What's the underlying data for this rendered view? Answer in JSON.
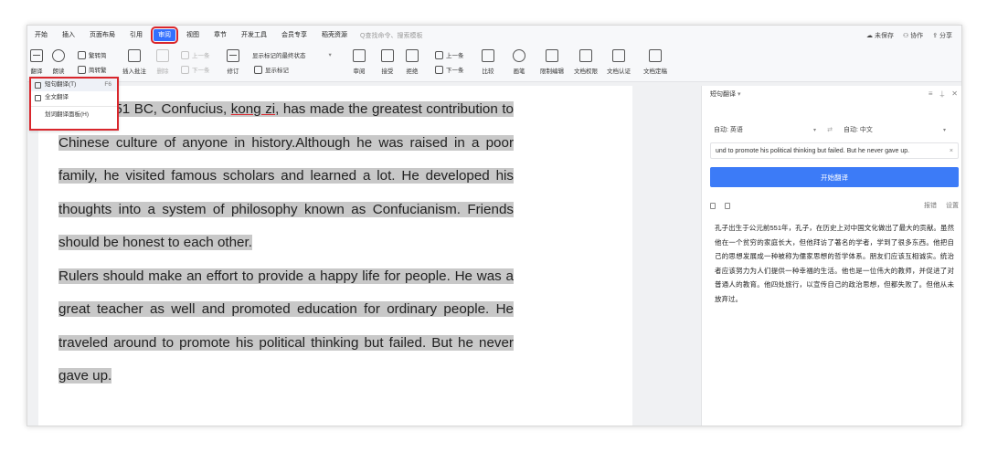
{
  "menu": {
    "tabs": [
      "开始",
      "插入",
      "页面布局",
      "引用",
      "审阅",
      "视图",
      "章节",
      "开发工具",
      "会员专享",
      "稻壳资源"
    ],
    "active_tab": "审阅",
    "search_placeholder": "Q查找命令、搜索模板",
    "right": [
      "未保存",
      "协作",
      "分享"
    ]
  },
  "ribbon": {
    "translate_btn": "翻译",
    "read_btn": "朗读",
    "trad_to_simp": "繁转简",
    "simp_to_trad": "简转繁",
    "insert_comment": "插入批注",
    "delete": "删除",
    "prev_comment": "上一条",
    "next_comment": "下一条",
    "revise": "修订",
    "markup_select": "显示标记的最终状态",
    "show_markup": "显示标记",
    "review": "审阅",
    "accept": "接受",
    "reject": "拒绝",
    "prev": "上一条",
    "next": "下一条",
    "compare": "比较",
    "ink": "画笔",
    "restrict_edit": "限制编辑",
    "doc_permission": "文档权限",
    "doc_auth": "文档认证",
    "doc_finalize": "文档定稿"
  },
  "dropdown": {
    "items": [
      {
        "label": "短句翻译(T)",
        "shortcut": "F6"
      },
      {
        "label": "全文翻译",
        "shortcut": ""
      },
      {
        "label": "划词翻译面板(H)",
        "shortcut": ""
      }
    ]
  },
  "document": {
    "p1_before": "Born in 551 BC, Confucius, ",
    "p1_kongzi": "kong zi",
    "p1_after": ", has made the greatest contribution to Chinese culture of anyone in history.Although he was raised in a poor family, he visited famous scholars and learned a lot. He developed his thoughts into a system of philosophy known as Confucianism. Friends should be honest to each other.",
    "p2": "Rulers should make an effort to provide a happy life for people. He was a great teacher as well and promoted education for ordinary people. He traveled around to promote his political thinking but failed. But he never gave up."
  },
  "panel": {
    "title": "短句翻译",
    "source_lang": "自动: 英语",
    "target_lang": "自动: 中文",
    "source_text": "und to promote his political thinking but failed. But he never gave up.",
    "translate_button": "开始翻译",
    "report": "报错",
    "settings": "设置",
    "result": "孔子出生于公元前551年，孔子，在历史上对中国文化做出了最大的贡献。虽然他在一个贫穷的家庭长大，但他拜访了著名的学者，学到了很多东西。他把自己的思想发展成一种被称为儒家思想的哲学体系。朋友们应该互相诚实。统治者应该努力为人们提供一种幸福的生活。他也是一位伟大的教师，并促进了对普通人的教育。他四处旅行，以宣传自己的政治思想，但都失败了。但他从未放弃过。"
  }
}
